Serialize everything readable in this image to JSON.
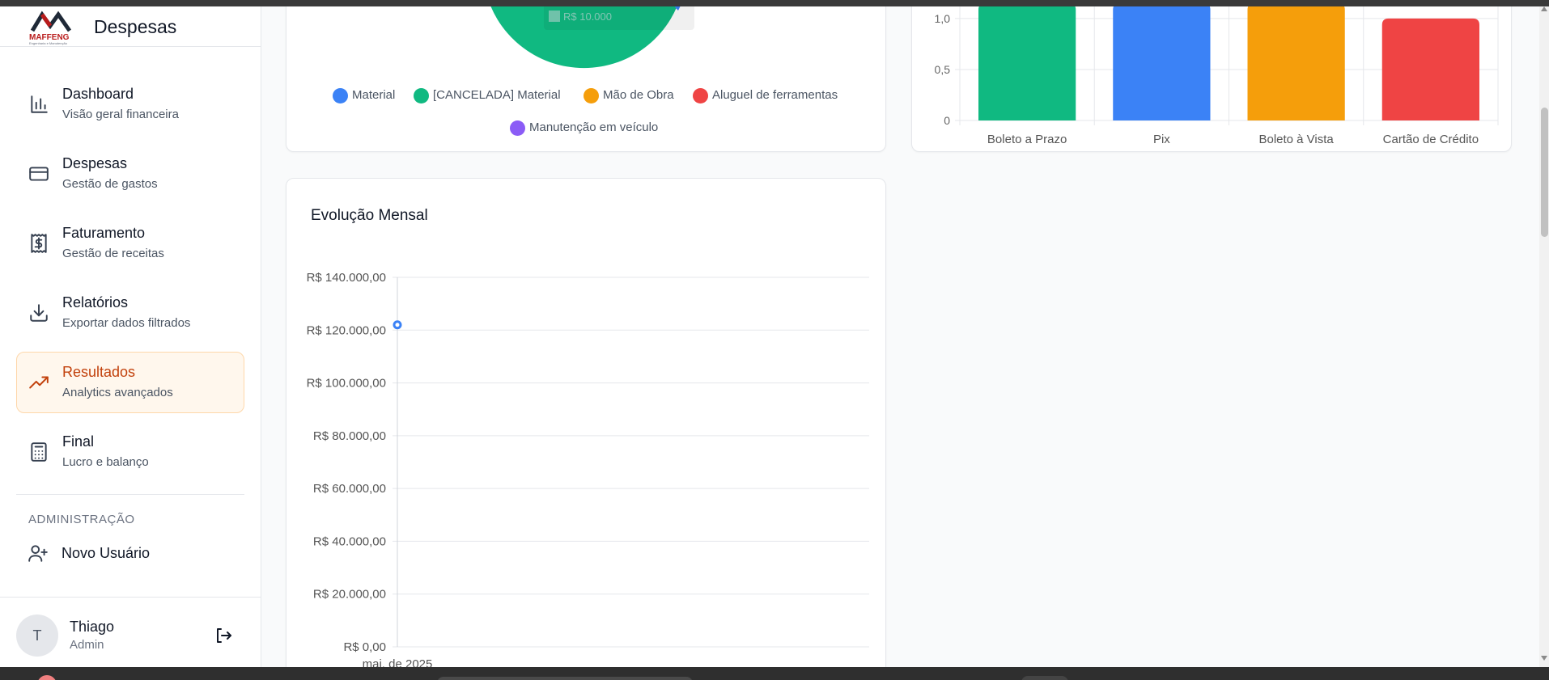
{
  "app": {
    "brand_title": "Despesas",
    "logo_text": "MAFFENG",
    "logo_subtext": "Engenharia e Manutenção"
  },
  "sidebar": {
    "items": [
      {
        "title": "Dashboard",
        "subtitle": "Visão geral financeira",
        "icon": "bar-chart-icon",
        "active": false
      },
      {
        "title": "Despesas",
        "subtitle": "Gestão de gastos",
        "icon": "credit-card-icon",
        "active": false
      },
      {
        "title": "Faturamento",
        "subtitle": "Gestão de receitas",
        "icon": "receipt-icon",
        "active": false
      },
      {
        "title": "Relatórios",
        "subtitle": "Exportar dados filtrados",
        "icon": "download-icon",
        "active": false
      },
      {
        "title": "Resultados",
        "subtitle": "Analytics avançados",
        "icon": "trending-up-icon",
        "active": true
      },
      {
        "title": "Final",
        "subtitle": "Lucro e balanço",
        "icon": "calculator-icon",
        "active": false
      }
    ],
    "admin_label": "ADMINISTRAÇÃO",
    "admin_item": {
      "title": "Novo Usuário",
      "icon": "user-plus-icon"
    }
  },
  "user": {
    "initial": "T",
    "name": "Thiago",
    "role": "Admin"
  },
  "pie_card": {
    "legend": [
      {
        "label": "Material",
        "color": "#3b82f6"
      },
      {
        "label": "[CANCELADA] Material",
        "color": "#10b981"
      },
      {
        "label": "Mão de Obra",
        "color": "#f59e0b"
      },
      {
        "label": "Aluguel de ferramentas",
        "color": "#ef4444"
      },
      {
        "label": "Manutenção em veículo",
        "color": "#8b5cf6"
      }
    ],
    "tooltip_value": "R$ 10.000"
  },
  "bar_card": {
    "y_ticks": [
      "1,0",
      "0,5",
      "0"
    ],
    "categories": [
      "Boleto a Prazo",
      "Pix",
      "Boleto à Vista",
      "Cartão de Crédito"
    ],
    "colors": [
      "#10b981",
      "#3b82f6",
      "#f59e0b",
      "#ef4444"
    ]
  },
  "line_card": {
    "title": "Evolução Mensal",
    "y_ticks": [
      "R$ 140.000,00",
      "R$ 120.000,00",
      "R$ 100.000,00",
      "R$ 80.000,00",
      "R$ 60.000,00",
      "R$ 40.000,00",
      "R$ 20.000,00",
      "R$ 0,00"
    ],
    "x_tick": "mai. de 2025",
    "point_color": "#3b82f6"
  },
  "chart_data": [
    {
      "type": "bar",
      "title": "",
      "categories": [
        "Boleto a Prazo",
        "Pix",
        "Boleto à Vista",
        "Cartão de Crédito"
      ],
      "values": [
        1.15,
        1.15,
        1.15,
        1.0
      ],
      "ylim": [
        0,
        1.15
      ],
      "y_ticks": [
        0,
        0.5,
        1.0
      ],
      "grid": true,
      "xlabel": "",
      "ylabel": ""
    },
    {
      "type": "line",
      "title": "Evolução Mensal",
      "x": [
        "mai. de 2025"
      ],
      "series": [
        {
          "values": [
            122000
          ]
        }
      ],
      "ylim": [
        0,
        140000
      ],
      "y_ticks": [
        0,
        20000,
        40000,
        60000,
        80000,
        100000,
        120000,
        140000
      ],
      "grid": true,
      "xlabel": "",
      "ylabel": ""
    }
  ]
}
